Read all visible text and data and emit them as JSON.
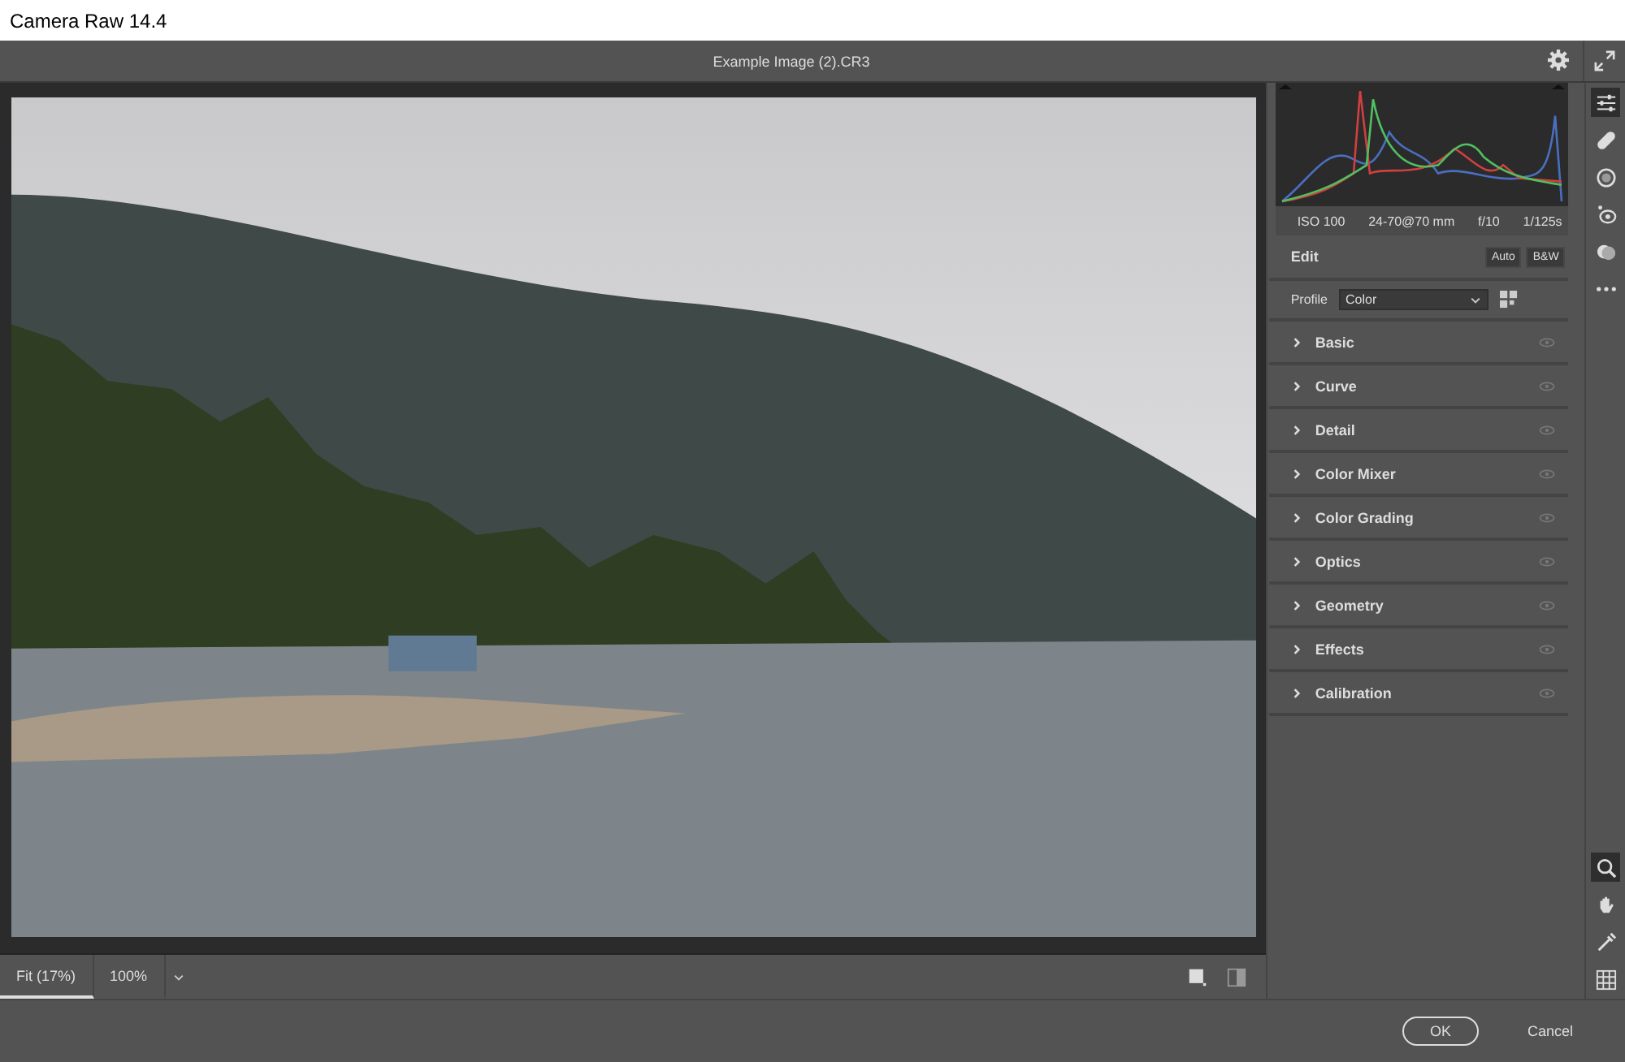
{
  "window": {
    "title": "Camera Raw 14.4"
  },
  "file_name": "Example Image (2).CR3",
  "exif": [
    "ISO 100",
    "24-70@70 mm",
    "f/10",
    "1/125s"
  ],
  "edit": {
    "label": "Edit",
    "buttons": [
      "Auto",
      "B&W"
    ]
  },
  "profile": {
    "label": "Profile",
    "value": "Color"
  },
  "sections": [
    {
      "label": "Basic",
      "expanded": false
    },
    {
      "label": "Curve",
      "expanded": false
    },
    {
      "label": "Detail",
      "expanded": false
    },
    {
      "label": "Color Mixer",
      "expanded": false
    },
    {
      "label": "Color Grading",
      "expanded": false
    },
    {
      "label": "Optics",
      "expanded": false
    },
    {
      "label": "Geometry",
      "expanded": false
    },
    {
      "label": "Effects",
      "expanded": false
    },
    {
      "label": "Calibration",
      "expanded": false
    }
  ],
  "top_tools": [
    {
      "kind": "sliders",
      "selected": true
    },
    {
      "kind": "bandage",
      "selected": false
    },
    {
      "kind": "mask",
      "selected": false
    },
    {
      "kind": "redeye",
      "selected": false
    },
    {
      "kind": "presets",
      "selected": false
    },
    {
      "kind": "more",
      "selected": false
    }
  ],
  "bottom_tools": [
    {
      "kind": "zoom",
      "selected": true
    },
    {
      "kind": "hand",
      "selected": false
    },
    {
      "kind": "sampler",
      "selected": false
    },
    {
      "kind": "grid",
      "selected": false
    }
  ],
  "zoom_options": [
    {
      "label": "Fit (17%)",
      "selected": true
    },
    {
      "label": "100%",
      "selected": false
    }
  ],
  "buttons": [
    {
      "label": "OK",
      "kind": "primary"
    },
    {
      "label": "Cancel",
      "kind": "secondary"
    }
  ]
}
